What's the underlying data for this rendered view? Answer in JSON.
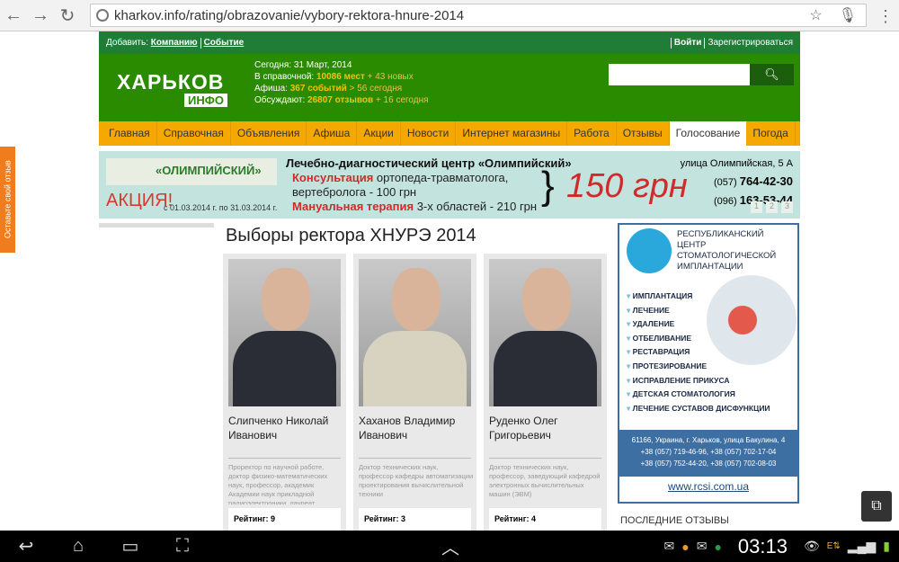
{
  "browser": {
    "url": "kharkov.info/rating/obrazovanie/vybory-rektora-hnure-2014"
  },
  "side_tab": "Оставьте свой отзыв",
  "topbar": {
    "add": "Добавить:",
    "company": "Компанию",
    "event": "Событие",
    "login": "Войти",
    "register": "Зарегистрироваться"
  },
  "logo": {
    "main": "ХАРЬКОВ",
    "sub": "ИНФО"
  },
  "stats": {
    "today": "Сегодня: 31 Март, 2014",
    "dir_label": "В справочной:",
    "dir_count": "10086 мест",
    "dir_new": "+ 43 новых",
    "afisha_label": "Афиша:",
    "afisha_count": "367 событий",
    "afisha_new": "> 56 сегодня",
    "discuss_label": "Обсуждают:",
    "discuss_count": "26807 отзывов",
    "discuss_new": "+ 16 сегодня"
  },
  "nav": [
    "Главная",
    "Справочная",
    "Объявления",
    "Афиша",
    "Акции",
    "Новости",
    "Интернет магазины",
    "Работа",
    "Отзывы",
    "Голосование",
    "Погода"
  ],
  "banner": {
    "brand": "«ОЛИМПИЙСКИЙ»",
    "promo": "АКЦИЯ!",
    "dates": "с 01.03.2014 г. по 31.03.2014 г.",
    "title": "Лечебно-диагностический центр «Олимпийский»",
    "l1a": "Консультация",
    "l1b": " ортопеда-травматолога,",
    "l2": "вертебролога - 100 грн",
    "l3a": "Мануальная терапия",
    "l3b": " 3-х областей - 210 грн",
    "price": "150 грн",
    "address": "улица Олимпийская, 5 А",
    "phone1_code": "(057)",
    "phone1": "764-42-30",
    "phone2_code": "(096)",
    "phone2": "163-53-44",
    "pages": [
      "1",
      "2",
      "3"
    ]
  },
  "page_title": "Выборы ректора ХНУРЭ 2014",
  "candidates": [
    {
      "name": "Слипченко Николай Иванович",
      "desc": "Проректор по научной работе, доктор физико-математических наук, профессор, академик Академии наук прикладной радиоэлектроники, лауреат",
      "rating": "Рейтинг: 9"
    },
    {
      "name": "Хаханов Владимир Иванович",
      "desc": "Доктор технических наук, профессор кафедры автоматизации проектирования вычислительной техники",
      "rating": "Рейтинг: 3"
    },
    {
      "name": "Руденко Олег Григорьевич",
      "desc": "Доктор технических наук, профессор, заведующий кафедрой электронных вычислительных машин (ЭВМ)",
      "rating": "Рейтинг: 4"
    }
  ],
  "ad": {
    "title": "РЕСПУБЛИКАНСКИЙ ЦЕНТР СТОМАТОЛОГИЧЕСКОЙ ИМПЛАНТАЦИИ",
    "services": [
      "ИМПЛАНТАЦИЯ",
      "ЛЕЧЕНИЕ",
      "УДАЛЕНИЕ",
      "ОТБЕЛИВАНИЕ",
      "РЕСТАВРАЦИЯ",
      "ПРОТЕЗИРОВАНИЕ",
      "ИСПРАВЛЕНИЕ ПРИКУСА",
      "ДЕТСКАЯ СТОМАТОЛОГИЯ",
      "ЛЕЧЕНИЕ СУСТАВОВ ДИСФУНКЦИИ"
    ],
    "address": "61166, Украина, г. Харьков, улица Бакулина, 4",
    "phones1": "+38 (057) 719-46-96, +38 (057) 702-17-04",
    "phones2": "+38 (057) 752-44-20, +38 (057) 702-08-03",
    "site": "www.rcsi.com.ua"
  },
  "last_reviews": "ПОСЛЕДНИЕ ОТЗЫВЫ",
  "system": {
    "time": "03:13"
  }
}
